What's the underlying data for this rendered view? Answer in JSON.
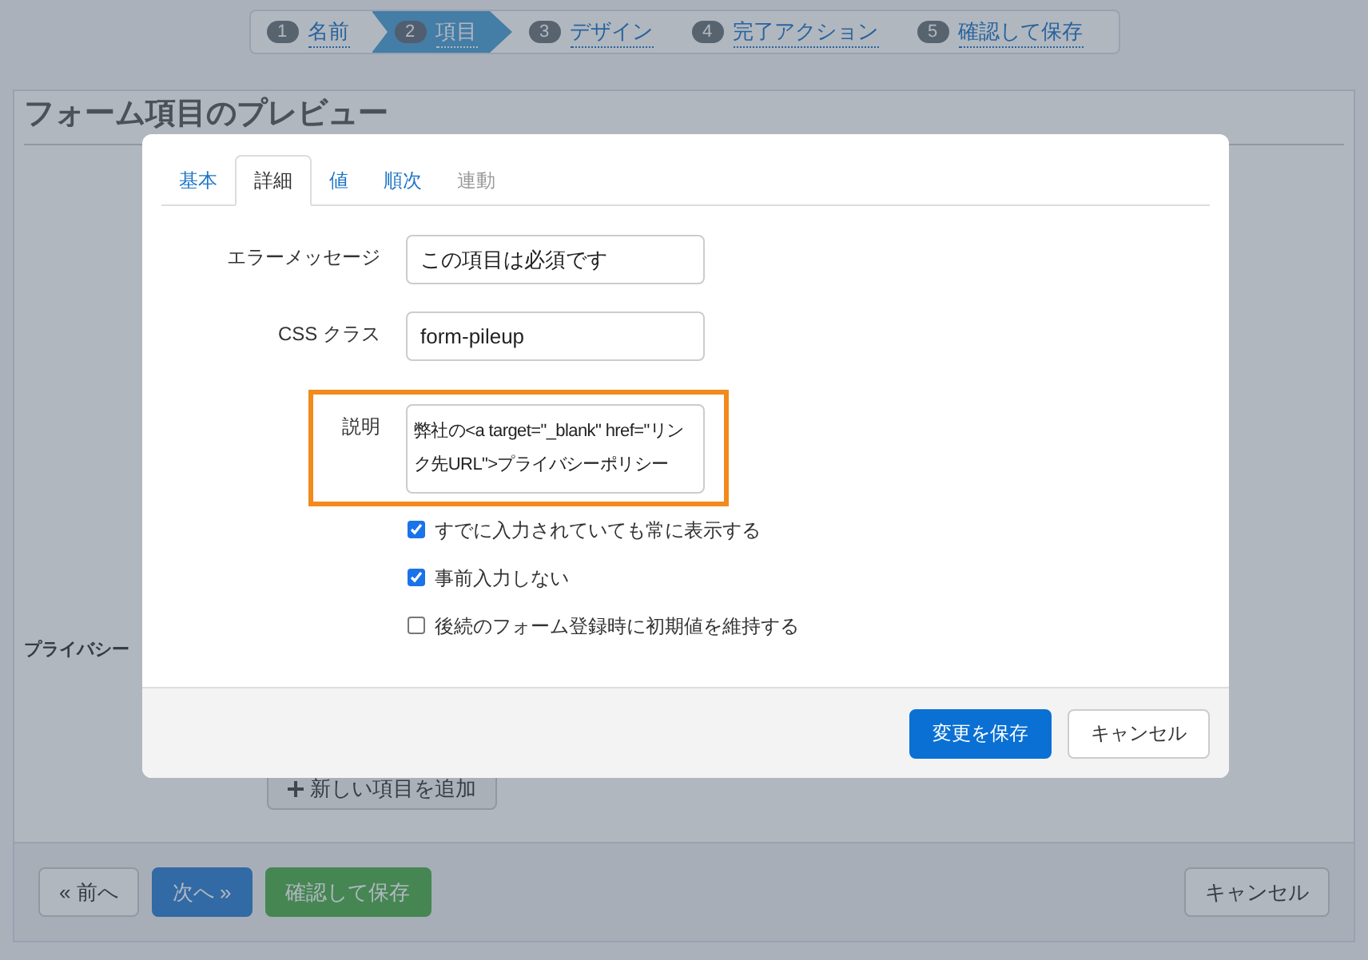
{
  "wizard_steps": [
    {
      "number": "1",
      "label": "名前",
      "selected": false
    },
    {
      "number": "2",
      "label": "項目",
      "selected": true
    },
    {
      "number": "3",
      "label": "デザイン",
      "selected": false
    },
    {
      "number": "4",
      "label": "完了アクション",
      "selected": false
    },
    {
      "number": "5",
      "label": "確認して保存",
      "selected": false
    }
  ],
  "page": {
    "title": "フォーム項目のプレビュー",
    "field_label": "プライバシー",
    "add_button": "新しい項目を追加"
  },
  "footer_buttons": [
    {
      "label": "« 前へ",
      "kind": "default"
    },
    {
      "label": "次へ »",
      "kind": "primary"
    },
    {
      "label": "確認して保存",
      "kind": "success"
    },
    {
      "label": "キャンセル",
      "kind": "cancel"
    }
  ],
  "dialog": {
    "tabs": [
      {
        "label": "基本",
        "selected": false,
        "disabled": false
      },
      {
        "label": "詳細",
        "selected": true,
        "disabled": false
      },
      {
        "label": "値",
        "selected": false,
        "disabled": false
      },
      {
        "label": "順次",
        "selected": false,
        "disabled": false
      },
      {
        "label": "連動",
        "selected": false,
        "disabled": true
      }
    ],
    "fields": [
      {
        "label": "エラーメッセージ",
        "value": "この項目は必須です",
        "kind": "input",
        "highlighted": false
      },
      {
        "label": "CSS クラス",
        "value": "form-pileup",
        "kind": "input",
        "highlighted": false
      },
      {
        "label": "説明",
        "value": "弊社の<a target=\"_blank\" href=\"リンク先URL\">プライバシーポリシー",
        "kind": "textarea",
        "highlighted": true
      }
    ],
    "checkboxes": [
      {
        "label": "すでに入力されていても常に表示する",
        "checked": true
      },
      {
        "label": "事前入力しない",
        "checked": true
      },
      {
        "label": "後続のフォーム登録時に初期値を維持する",
        "checked": false
      }
    ],
    "buttons": [
      {
        "label": "変更を保存",
        "kind": "primary"
      },
      {
        "label": "キャンセル",
        "kind": "default"
      }
    ]
  }
}
